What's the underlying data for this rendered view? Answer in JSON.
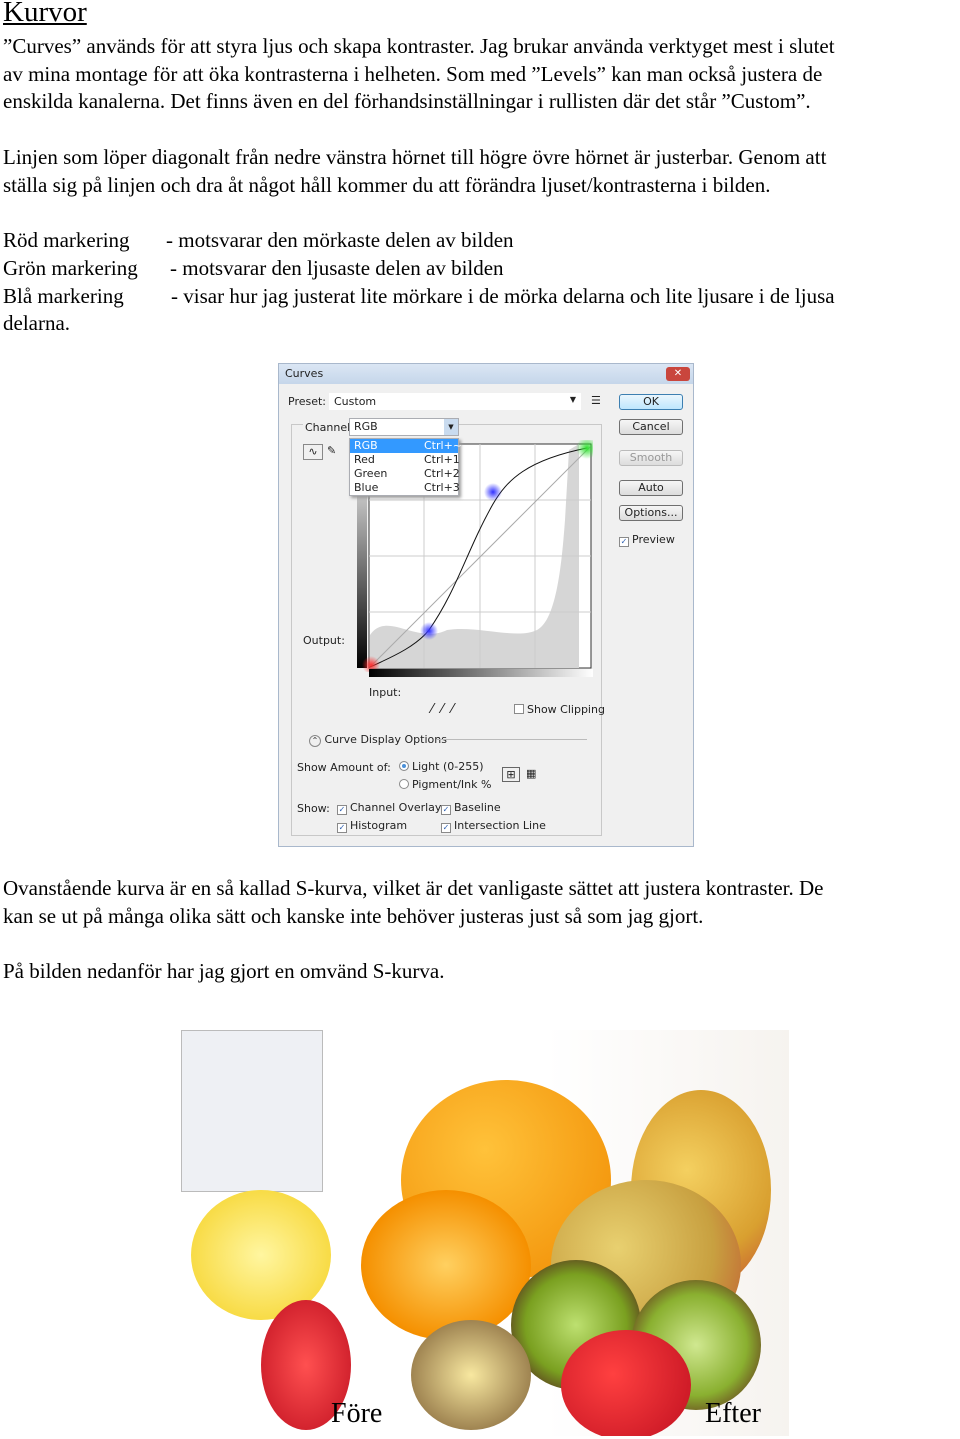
{
  "title": "Kurvor",
  "p1": [
    "”Curves” används för att styra ljus och skapa kontraster. Jag brukar använda verktyget mest i slutet",
    "av mina montage för att öka kontrasterna i helheten. Som med ”Levels” kan man också justera de",
    "enskilda kanalerna. Det finns även en del förhandsinställningar i rullisten där det står ”Custom”."
  ],
  "p2": [
    "Linjen som löper diagonalt från nedre vänstra hörnet till högre övre hörnet är justerbar. Genom att",
    "ställa sig på linjen och dra åt något håll kommer du att förändra ljuset/kontrasterna i bilden."
  ],
  "markers": [
    {
      "label": "Röd markering",
      "desc": "- motsvarar den mörkaste delen av bilden"
    },
    {
      "label": "Grön markering",
      "desc": "- motsvarar den ljusaste delen av bilden"
    },
    {
      "label": "Blå markering",
      "desc": "- visar hur jag justerat lite mörkare i de mörka delarna och lite ljusare i de ljusa"
    }
  ],
  "markers_cont": "delarna.",
  "dialog": {
    "title": "Curves",
    "preset_label": "Preset:",
    "preset_value": "Custom",
    "channel_label": "Channel:",
    "channel_value": "RGB",
    "channels": [
      {
        "name": "RGB",
        "key": "Ctrl+~"
      },
      {
        "name": "Red",
        "key": "Ctrl+1"
      },
      {
        "name": "Green",
        "key": "Ctrl+2"
      },
      {
        "name": "Blue",
        "key": "Ctrl+3"
      }
    ],
    "buttons": {
      "ok": "OK",
      "cancel": "Cancel",
      "smooth": "Smooth",
      "auto": "Auto",
      "options": "Options..."
    },
    "preview": "Preview",
    "output": "Output:",
    "input": "Input:",
    "show_clipping": "Show Clipping",
    "display_options": "Curve Display Options",
    "show_amount": "Show Amount of:",
    "light": "Light  (0-255)",
    "pigment": "Pigment/Ink %",
    "show": "Show:",
    "channel_overlays": "Channel Overlays",
    "baseline": "Baseline",
    "histogram": "Histogram",
    "intersection": "Intersection Line",
    "colors": {
      "red_point": "#ff3030",
      "green_point": "#30e030",
      "blue_point": "#3030ff"
    }
  },
  "p3": [
    "Ovanstående kurva är en så kallad S-kurva, vilket är det vanligaste sättet att justera kontraster. De",
    "kan se ut på många olika sätt och kanske inte behöver justeras just så som jag gjort."
  ],
  "p4": "På bilden nedanför har jag gjort en omvänd S-kurva.",
  "photo": {
    "before": "Före",
    "after": "Efter"
  }
}
